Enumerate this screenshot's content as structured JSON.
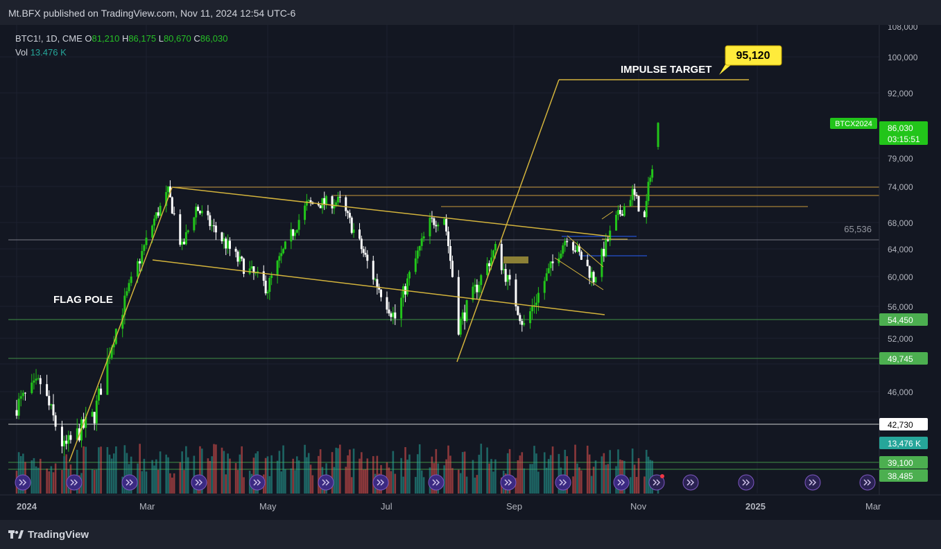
{
  "header": {
    "published": "Mt.BFX published on TradingView.com, Nov 11, 2024 12:54 UTC-6"
  },
  "footer": {
    "brand": "TradingView"
  },
  "legend": {
    "symbol": "BTC1!, 1D, CME",
    "o_label": "O",
    "o": "81,210",
    "h_label": "H",
    "h": "86,175",
    "l_label": "L",
    "l": "80,670",
    "c_label": "C",
    "c": "86,030",
    "vol_label": "Vol",
    "vol": "13.476 K"
  },
  "colors": {
    "background": "#131722",
    "up": "#22c51a",
    "down": "#ffffff",
    "vol_up": "#26a69a",
    "vol_down": "#ef5350",
    "annotation": "#d4b43c",
    "level": "#4caf50",
    "badge": "#ffeb3b"
  },
  "chart_data": {
    "type": "candlestick",
    "symbol": "BTC1!",
    "interval": "1D",
    "exchange": "CME",
    "x_ticks": [
      "2024",
      "Mar",
      "May",
      "Jul",
      "Sep",
      "Nov",
      "2025",
      "Mar"
    ],
    "y_ticks": [
      "108,000",
      "100,000",
      "92,000",
      "86,030",
      "79,000",
      "74,000",
      "68,000",
      "65,536",
      "64,000",
      "60,000",
      "56,000",
      "54,450",
      "52,000",
      "49,745",
      "46,000",
      "42,730",
      "39,100",
      "38,485"
    ],
    "price_labels": [
      {
        "value": "86,030",
        "sub": "03:15:51",
        "color": "#22c51a",
        "tag": "BTCX2024"
      },
      {
        "value": "54,450",
        "color": "#4caf50"
      },
      {
        "value": "49,745",
        "color": "#4caf50"
      },
      {
        "value": "42,730",
        "color": "#ffffff"
      },
      {
        "value": "13,476 K",
        "color": "#26a69a"
      },
      {
        "value": "39,100",
        "color": "#4caf50"
      },
      {
        "value": "38,485",
        "color": "#4caf50"
      }
    ],
    "horizontal_levels": [
      65536,
      54450,
      49745,
      42730,
      39100,
      38485
    ],
    "annotations": {
      "flag_pole": "FLAG POLE",
      "impulse_target": "IMPULSE TARGET",
      "target_badge": "95,120",
      "level_label": "65,536"
    },
    "swing_points": [
      {
        "date": "2024-01-23",
        "price": 38500
      },
      {
        "date": "2024-03-10",
        "price": 73800
      },
      {
        "date": "2024-08-05",
        "price": 49500
      },
      {
        "date": "2024-09-28",
        "price": 95120
      }
    ],
    "trend_lines": [
      {
        "name": "upper",
        "start": [
          "2024-03-10",
          73800
        ],
        "end": [
          "2024-10-14",
          65800
        ]
      },
      {
        "name": "lower",
        "start": [
          "2024-03-01",
          63000
        ],
        "end": [
          "2024-10-14",
          55200
        ]
      }
    ],
    "last": {
      "open": 81210,
      "high": 86175,
      "low": 80670,
      "close": 86030,
      "volume": "13.476 K"
    }
  }
}
